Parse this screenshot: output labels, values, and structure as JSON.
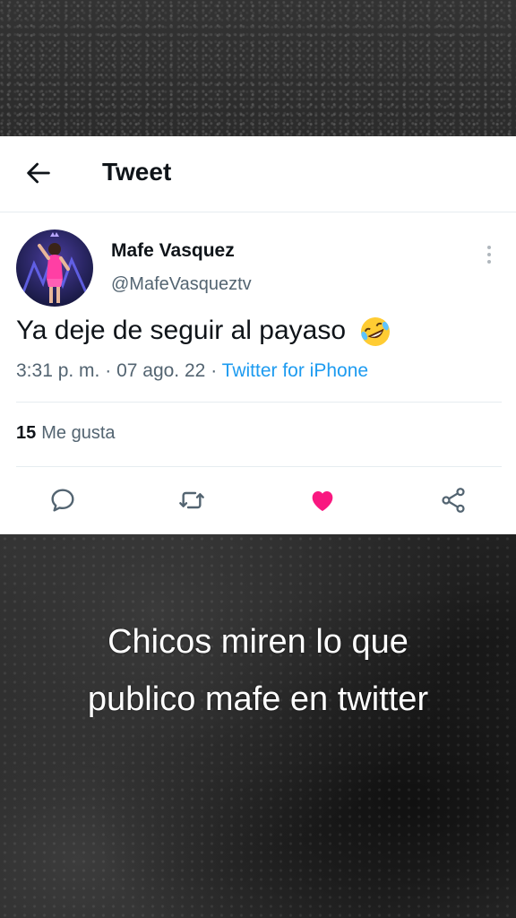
{
  "header": {
    "title": "Tweet",
    "back_icon": "back-arrow-icon"
  },
  "tweet": {
    "author_name": "Mafe Vasquez",
    "author_handle": "@MafeVasqueztv",
    "text": "Ya deje de seguir al payaso",
    "emoji": "rolling-on-floor-laughing-emoji",
    "time": "3:31 p. m.",
    "date": "07 ago. 22",
    "separator": "·",
    "source": "Twitter for iPhone",
    "likes_count": "15",
    "likes_label": "Me gusta",
    "liked": true
  },
  "actions": [
    {
      "icon": "reply-icon"
    },
    {
      "icon": "retweet-icon"
    },
    {
      "icon": "like-heart-icon",
      "color": "#f91880"
    },
    {
      "icon": "share-icon"
    }
  ],
  "caption": {
    "line1": "Chicos miren lo que",
    "line2": "publico mafe en twitter"
  },
  "colors": {
    "accent": "#1d9bf0",
    "like": "#f91880",
    "text_primary": "#0f1419",
    "text_secondary": "#536471"
  }
}
